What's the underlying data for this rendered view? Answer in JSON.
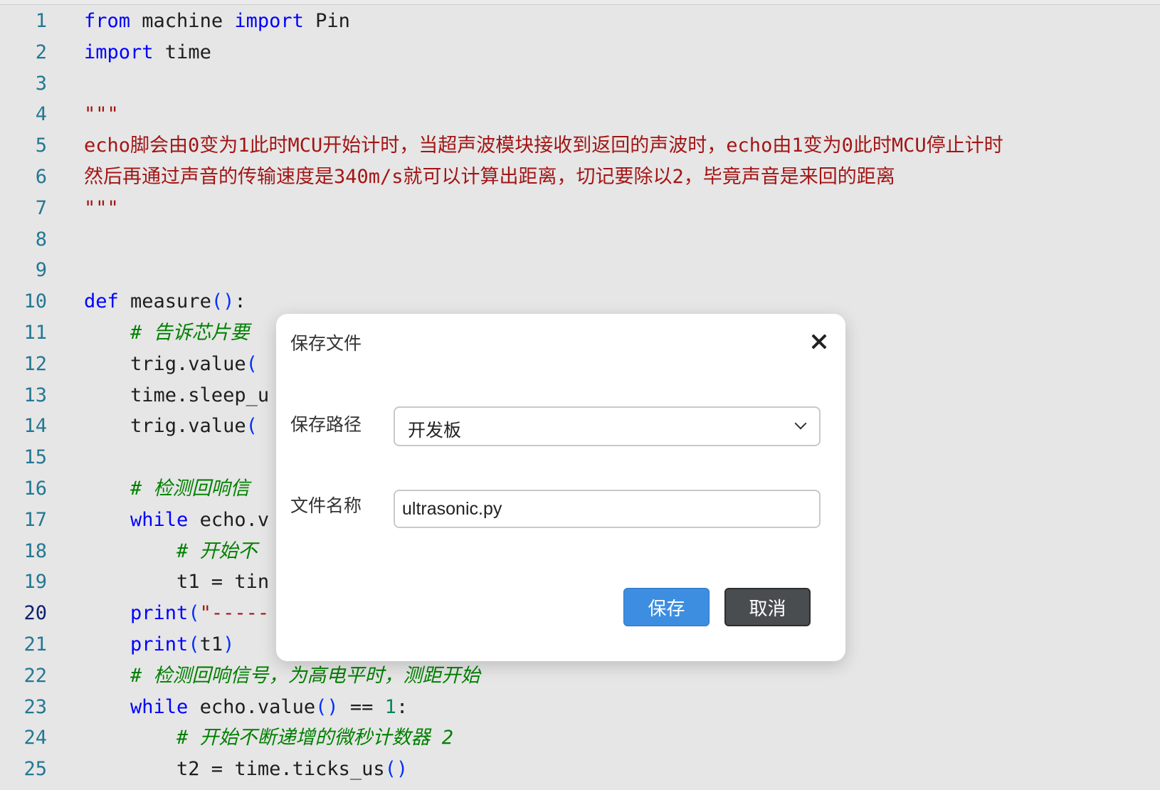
{
  "editor": {
    "active_line": 20,
    "lines": [
      {
        "n": "1",
        "tokens": [
          {
            "t": "from",
            "c": "kw"
          },
          {
            "t": " machine "
          },
          {
            "t": "import",
            "c": "kw"
          },
          {
            "t": " Pin"
          }
        ]
      },
      {
        "n": "2",
        "tokens": [
          {
            "t": "import",
            "c": "kw"
          },
          {
            "t": " time"
          }
        ]
      },
      {
        "n": "3",
        "tokens": []
      },
      {
        "n": "4",
        "tokens": [
          {
            "t": "\"\"\"",
            "c": "str"
          }
        ]
      },
      {
        "n": "5",
        "tokens": [
          {
            "t": "echo脚会由0变为1此时MCU开始计时，当超声波模块接收到返回的声波时，echo由1变为0此时MCU停止计时",
            "c": "str"
          }
        ]
      },
      {
        "n": "6",
        "tokens": [
          {
            "t": "然后再通过声音的传输速度是340m/s就可以计算出距离，切记要除以2，毕竟声音是来回的距离",
            "c": "str"
          }
        ]
      },
      {
        "n": "7",
        "tokens": [
          {
            "t": "\"\"\"",
            "c": "str"
          }
        ]
      },
      {
        "n": "8",
        "tokens": []
      },
      {
        "n": "9",
        "tokens": []
      },
      {
        "n": "10",
        "tokens": [
          {
            "t": "def",
            "c": "kw"
          },
          {
            "t": " measure"
          },
          {
            "t": "()",
            "c": "br"
          },
          {
            "t": ":"
          }
        ]
      },
      {
        "n": "11",
        "tokens": [
          {
            "t": "    "
          },
          {
            "t": "# 告诉芯片要",
            "c": "cm"
          }
        ]
      },
      {
        "n": "12",
        "tokens": [
          {
            "t": "    trig.value"
          },
          {
            "t": "(",
            "c": "br"
          }
        ]
      },
      {
        "n": "13",
        "tokens": [
          {
            "t": "    time.sleep_u"
          }
        ]
      },
      {
        "n": "14",
        "tokens": [
          {
            "t": "    trig.value"
          },
          {
            "t": "(",
            "c": "br"
          }
        ]
      },
      {
        "n": "15",
        "tokens": []
      },
      {
        "n": "16",
        "tokens": [
          {
            "t": "    "
          },
          {
            "t": "# 检测回响信",
            "c": "cm"
          }
        ]
      },
      {
        "n": "17",
        "tokens": [
          {
            "t": "    "
          },
          {
            "t": "while",
            "c": "kw"
          },
          {
            "t": " echo.v"
          }
        ]
      },
      {
        "n": "18",
        "tokens": [
          {
            "t": "        "
          },
          {
            "t": "# 开始不",
            "c": "cm"
          }
        ]
      },
      {
        "n": "19",
        "tokens": [
          {
            "t": "        t1 = tin"
          }
        ]
      },
      {
        "n": "20",
        "tokens": [
          {
            "t": "    "
          },
          {
            "t": "print",
            "c": "kw"
          },
          {
            "t": "(",
            "c": "br"
          },
          {
            "t": "\"-----",
            "c": "str"
          }
        ]
      },
      {
        "n": "21",
        "tokens": [
          {
            "t": "    "
          },
          {
            "t": "print",
            "c": "kw"
          },
          {
            "t": "(",
            "c": "br"
          },
          {
            "t": "t1"
          },
          {
            "t": ")",
            "c": "br"
          }
        ]
      },
      {
        "n": "22",
        "tokens": [
          {
            "t": "    "
          },
          {
            "t": "# 检测回响信号，为高电平时，测距开始",
            "c": "cm"
          }
        ]
      },
      {
        "n": "23",
        "tokens": [
          {
            "t": "    "
          },
          {
            "t": "while",
            "c": "kw"
          },
          {
            "t": " echo.value"
          },
          {
            "t": "()",
            "c": "br"
          },
          {
            "t": " == "
          },
          {
            "t": "1",
            "c": "num"
          },
          {
            "t": ":"
          }
        ]
      },
      {
        "n": "24",
        "tokens": [
          {
            "t": "        "
          },
          {
            "t": "# 开始不断递增的微秒计数器 2",
            "c": "cm"
          }
        ]
      },
      {
        "n": "25",
        "tokens": [
          {
            "t": "        t2 = time.ticks_us"
          },
          {
            "t": "()",
            "c": "br"
          }
        ]
      }
    ]
  },
  "dialog": {
    "title": "保存文件",
    "path_label": "保存路径",
    "path_value": "开发板",
    "name_label": "文件名称",
    "name_value": "ultrasonic.py",
    "save_label": "保存",
    "cancel_label": "取消"
  }
}
